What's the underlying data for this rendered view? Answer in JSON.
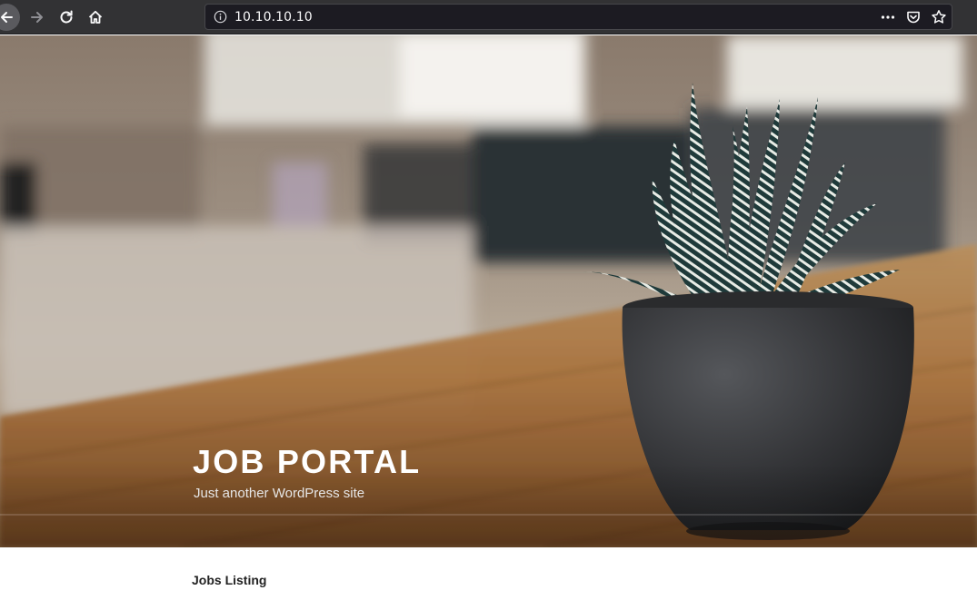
{
  "browser": {
    "url": "10.10.10.10",
    "icons": {
      "back": "arrow-left-icon",
      "forward": "arrow-right-icon",
      "reload": "reload-icon",
      "home": "home-icon",
      "info": "info-icon",
      "more": "more-icon",
      "pocket": "pocket-icon",
      "bookmark": "star-icon"
    }
  },
  "site": {
    "title": "JOB PORTAL",
    "description": "Just another WordPress site"
  },
  "nav": {
    "items": [
      {
        "label": "Jobs Listing"
      }
    ]
  },
  "colors": {
    "toolbar": "#323234",
    "urlbar": "#1c1b22",
    "title": "#ffffff",
    "nav_text": "#222222"
  }
}
